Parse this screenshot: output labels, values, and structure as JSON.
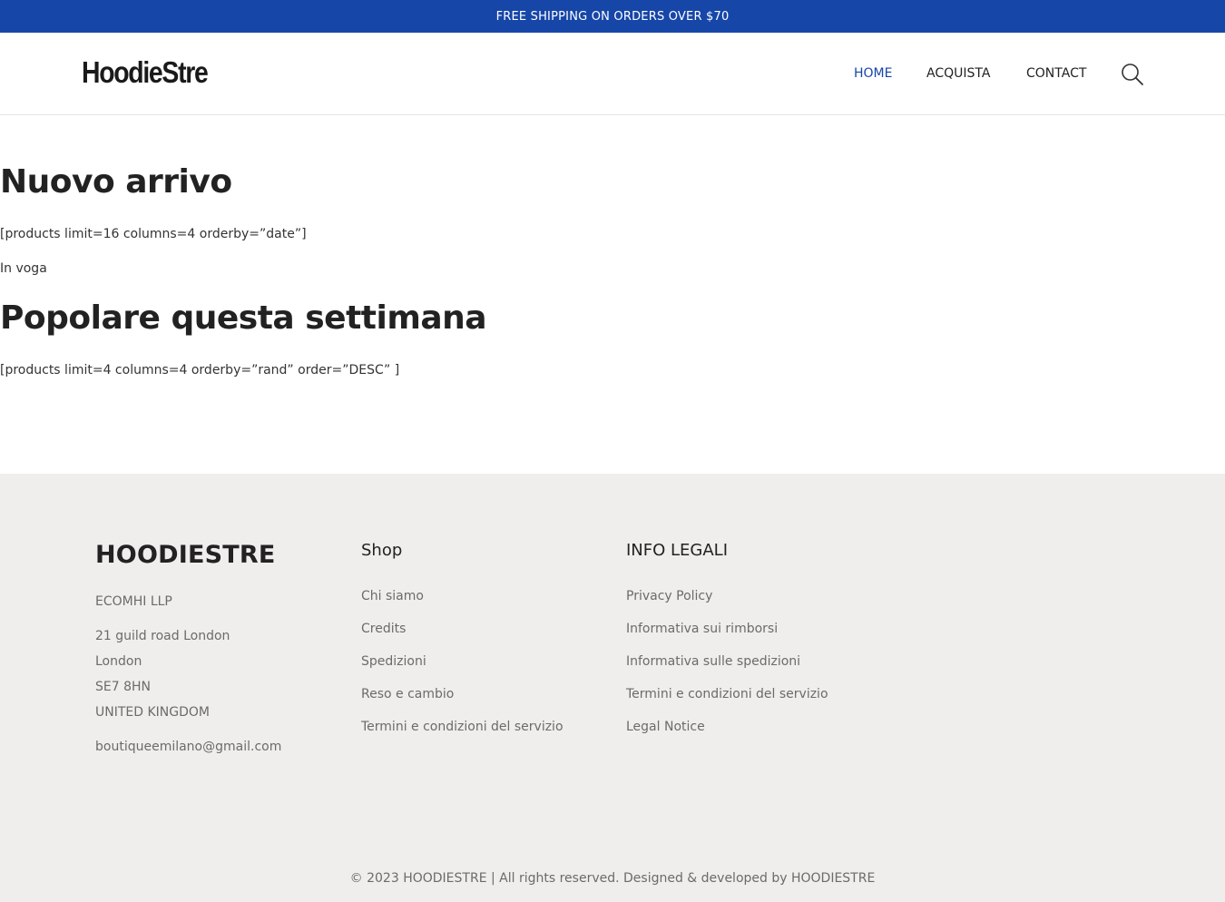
{
  "topbar": {
    "text": "FREE SHIPPING ON ORDERS OVER $70"
  },
  "header": {
    "logo": "HoodieStre",
    "nav": [
      {
        "label": "HOME",
        "active": true
      },
      {
        "label": "ACQUISTA",
        "active": false
      },
      {
        "label": "CONTACT",
        "active": false
      }
    ],
    "search_icon": "search-icon"
  },
  "main": {
    "title1": "Nuovo arrivo",
    "shortcode1": "[products limit=16 columns=4 orderby=”date”]",
    "label": "In voga",
    "title2": "Popolare questa settimana",
    "shortcode2": "[products limit=4 columns=4 orderby=”rand” order=”DESC” ]"
  },
  "footer": {
    "brand": "HOODIESTRE",
    "company": "ECOMHI LLP",
    "address": [
      "21 guild road London",
      "London",
      "SE7 8HN",
      "UNITED KINGDOM"
    ],
    "email": "boutiqueemilano@gmail.com",
    "shop": {
      "title": "Shop",
      "links": [
        "Chi siamo",
        "Credits",
        "Spedizioni",
        "Reso e cambio",
        "Termini e condizioni del servizio"
      ]
    },
    "legal": {
      "title": "INFO LEGALI",
      "links": [
        "Privacy Policy",
        "Informativa sui rimborsi",
        "Informativa sulle spedizioni",
        "Termini e condizioni del servizio",
        "Legal Notice"
      ]
    },
    "copyright": "© 2023 HOODIESTRE | All rights reserved. Designed & developed by HOODIESTRE"
  },
  "colors": {
    "accent": "#1646a8",
    "footer_bg": "#efeeec"
  }
}
